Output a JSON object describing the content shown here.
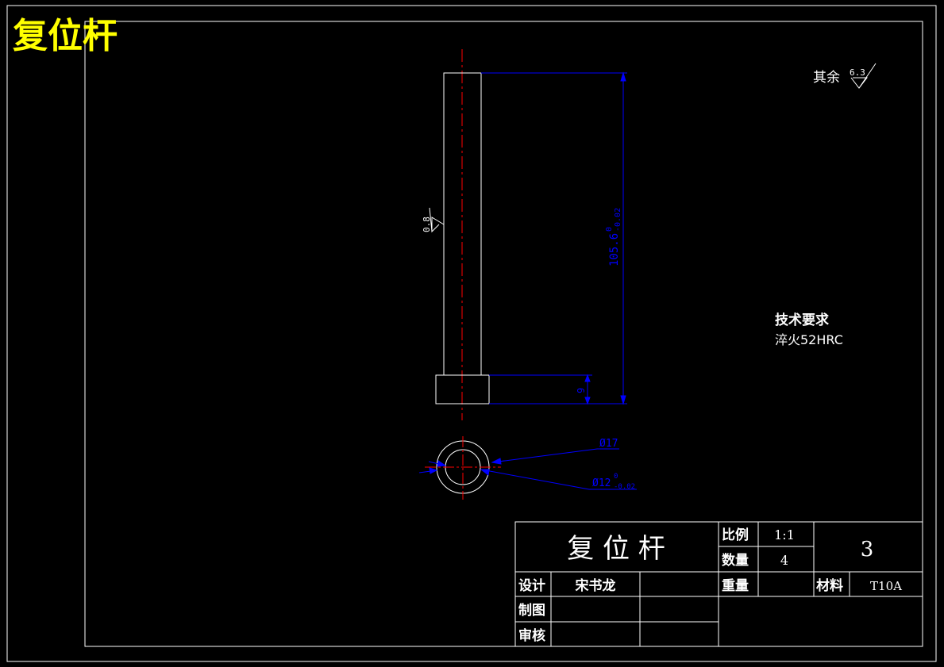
{
  "drawing": {
    "corner_title": "复位杆",
    "roughness_note": {
      "label": "其余",
      "value": "6.3"
    },
    "side_roughness": "0.8",
    "length_dim": {
      "nominal": "105.6",
      "upper": "0",
      "lower": "-0.02"
    },
    "head_dim": "9",
    "outer_dia": "Ø17",
    "inner_dia": {
      "nominal": "Ø12",
      "upper": "0",
      "lower": "-0.02"
    },
    "tech_req": {
      "heading": "技术要求",
      "line1": "淬火52HRC"
    }
  },
  "title_block": {
    "part_name": "复 位 杆",
    "scale_label": "比例",
    "scale_value": "1:1",
    "qty_label": "数量",
    "qty_value": "4",
    "sheet_no": "3",
    "design_label": "设计",
    "designer": "宋书龙",
    "weight_label": "重量",
    "material_label": "材料",
    "material_value": "T10A",
    "draw_label": "制图",
    "check_label": "审核"
  },
  "colors": {
    "line": "#ffffff",
    "dimension": "#0000ff",
    "center": "#ff0000",
    "title": "#ffff00"
  }
}
